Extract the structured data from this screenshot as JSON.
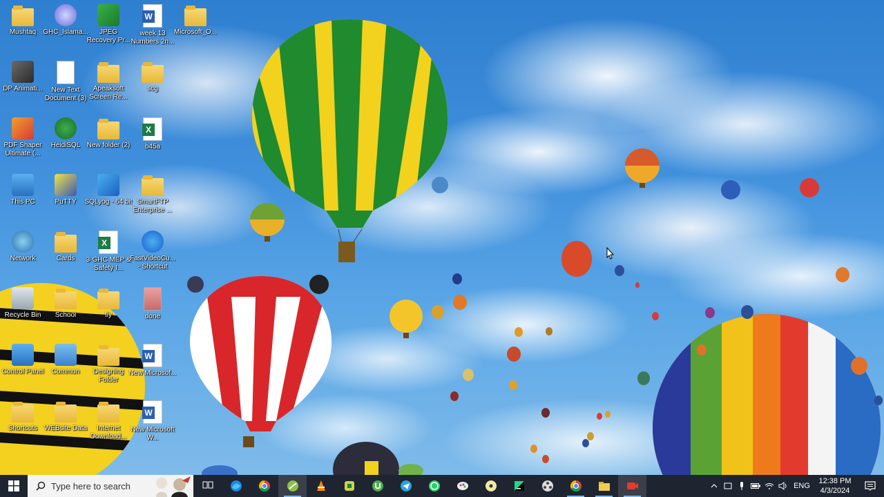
{
  "desktop": {
    "icons": [
      {
        "label": "Mushtaq",
        "icon": "user-folder-icon"
      },
      {
        "label": "GHC_Islama...",
        "icon": "disc-image-icon"
      },
      {
        "label": "JPEG Recovery Pr...",
        "icon": "recovery-app-icon"
      },
      {
        "label": "week 13 Numbers 2n...",
        "icon": "word-doc-icon"
      },
      {
        "label": "Microsoft_O...",
        "icon": "zip-folder-icon"
      },
      {
        "label": "DP Animati...",
        "icon": "animation-app-icon"
      },
      {
        "label": "New Text Document (3)",
        "icon": "text-file-icon"
      },
      {
        "label": "Apeaksoft Screen Re...",
        "icon": "folder-icon"
      },
      {
        "label": "scg",
        "icon": "folder-icon"
      },
      {
        "label": "PDF Shaper Ultimate (...",
        "icon": "pdf-app-icon"
      },
      {
        "label": "HeidiSQL",
        "icon": "heidisql-icon"
      },
      {
        "label": "New folder (2)",
        "icon": "folder-icon"
      },
      {
        "label": "b45a",
        "icon": "excel-doc-icon"
      },
      {
        "label": "This PC",
        "icon": "computer-icon"
      },
      {
        "label": "PuTTY",
        "icon": "putty-icon"
      },
      {
        "label": "SQLyog - 64 bit",
        "icon": "sqlyog-icon"
      },
      {
        "label": "SmartFTP Enterprise ...",
        "icon": "zip-folder-icon"
      },
      {
        "label": "Network",
        "icon": "network-icon"
      },
      {
        "label": "Cards",
        "icon": "folder-icon"
      },
      {
        "label": "3-GHC MEP & Safety I...",
        "icon": "excel-doc-icon"
      },
      {
        "label": "FastVideoCu... - Shortcut",
        "icon": "video-app-icon"
      },
      {
        "label": "Recycle Bin",
        "icon": "recycle-bin-icon"
      },
      {
        "label": "School",
        "icon": "folder-icon"
      },
      {
        "label": "fly",
        "icon": "folder-icon"
      },
      {
        "label": "done",
        "icon": "image-file-icon"
      },
      {
        "label": "Control Panel",
        "icon": "control-panel-icon"
      },
      {
        "label": "Common",
        "icon": "monitor-icon"
      },
      {
        "label": "Designing Folder",
        "icon": "folder-icon"
      },
      {
        "label": "New Microsof...",
        "icon": "word-doc-icon"
      },
      {
        "label": "Shortcuts",
        "icon": "folder-icon"
      },
      {
        "label": "WEBsite Data",
        "icon": "folder-icon"
      },
      {
        "label": "Internet Download...",
        "icon": "zip-folder-icon"
      },
      {
        "label": "New Microsoft W...",
        "icon": "word-doc-icon"
      }
    ]
  },
  "taskbar": {
    "search_placeholder": "Type here to search",
    "apps": [
      {
        "name": "task-view",
        "icon": "task-view-icon"
      },
      {
        "name": "edge",
        "icon": "edge-icon"
      },
      {
        "name": "chrome",
        "icon": "chrome-icon"
      },
      {
        "name": "snipping",
        "icon": "snip-icon"
      },
      {
        "name": "vlc",
        "icon": "vlc-icon"
      },
      {
        "name": "workbench",
        "icon": "puzzle-icon"
      },
      {
        "name": "utorrent",
        "icon": "utorrent-icon"
      },
      {
        "name": "telegram",
        "icon": "telegram-icon"
      },
      {
        "name": "whatsapp",
        "icon": "whatsapp-icon"
      },
      {
        "name": "paint",
        "icon": "palette-icon"
      },
      {
        "name": "dvd",
        "icon": "disc-icon"
      },
      {
        "name": "pycharm",
        "icon": "pycharm-icon"
      },
      {
        "name": "video-editor",
        "icon": "film-reel-icon"
      },
      {
        "name": "chrome-profile",
        "icon": "chrome-icon"
      },
      {
        "name": "file-explorer",
        "icon": "folder-icon"
      },
      {
        "name": "screen-recorder",
        "icon": "recorder-icon"
      }
    ],
    "tray": {
      "language": "ENG",
      "time": "12:38 PM",
      "date": "4/3/2024"
    }
  }
}
